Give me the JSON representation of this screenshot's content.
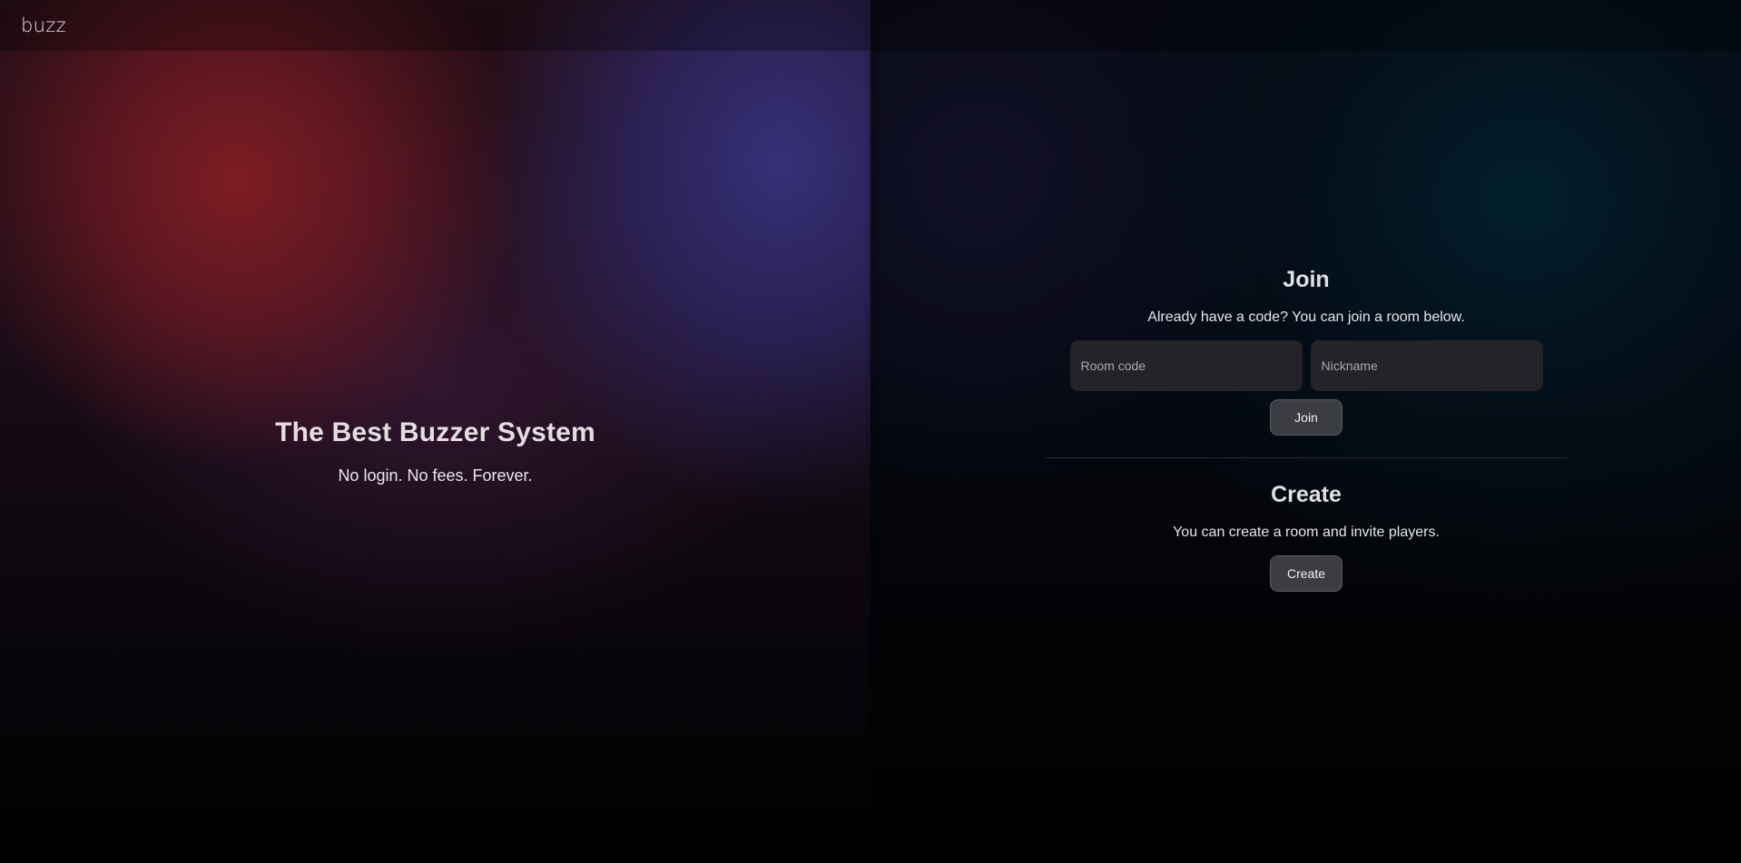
{
  "header": {
    "brand": "buzz"
  },
  "hero": {
    "title": "The Best Buzzer System",
    "subtitle": "No login. No fees. Forever."
  },
  "join": {
    "title": "Join",
    "description": "Already have a code? You can join a room below.",
    "room_code_placeholder": "Room code",
    "nickname_placeholder": "Nickname",
    "button_label": "Join"
  },
  "create": {
    "title": "Create",
    "description": "You can create a room and invite players.",
    "button_label": "Create"
  },
  "colors": {
    "hero_red": "#6e1e24",
    "hero_blue": "#2f2d6e",
    "input_bg": "#242328",
    "button_bg": "#3c3c43"
  }
}
